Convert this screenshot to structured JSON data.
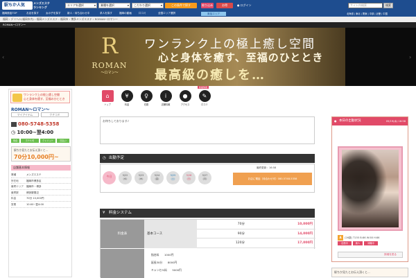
{
  "header": {
    "logo": "駅ちか人気",
    "logo_tag": "メンズエステ\nランキング",
    "select1": "エリアを選択",
    "select2": "業種を選択",
    "select3": "こだわり選択",
    "search_btn": "この条件で探す",
    "btn2": "絞り込み",
    "btn3": "お得",
    "login": "ログイン",
    "search_placeholder": "サイト内検索",
    "search_btn2": "検索"
  },
  "nav2": [
    "福岡風俗TOP",
    "お店を探す",
    "女の子を探す",
    "新人・待ち合わせ中",
    "求人を探す",
    "福岡の動画",
    "口コミ",
    "全国エリア選択",
    "風俗エリア"
  ],
  "nav3": "北海道 | 東北 | 関東 | 中部 | 近畿 | 中国",
  "breadcrumb": "福岡 › デリヘル(福岡市内) › 福岡メンズエステ › 福岡市 › 博多メンズエステ › ROMAN～ロマン～",
  "breadcrumb2": "ROMAN～ロマン～",
  "banner": {
    "t1": "ワンランク上の極上癒し空間",
    "t2": "心と身体を癒す、至福のひととき",
    "t3": "最高級の癒しを…",
    "logo_name": "ROMAN",
    "logo_sub": "～ロマン～",
    "logo_mark": "R"
  },
  "left": {
    "banner_text": "ワンランク上の極上癒し空間\n心と身体を癒す、至福のひととき",
    "shop_name": "ROMAN～ロマン～",
    "btn_a": "マイアイテム",
    "btn_b": "クチコミ",
    "tel": "080-5748-5358",
    "time": "10:00~翌4:00",
    "tags": [
      "待合",
      "ホテル可",
      "クレジット",
      "日払い"
    ],
    "price_sub": "駅ちか見たとお伝え頂くと...",
    "price_val": "70分10,000円~",
    "sec_title": "店舗基本情報",
    "info": [
      {
        "k": "業種",
        "v": "メンズエステ"
      },
      {
        "k": "所在地",
        "v": "福岡市博多区"
      },
      {
        "k": "最寄エリア",
        "v": "福岡市・博多"
      },
      {
        "k": "最寄駅",
        "v": "博多駅周辺"
      },
      {
        "k": "料金",
        "v": "70分 10,000円"
      },
      {
        "k": "営業",
        "v": "10:00~翌4:00"
      }
    ]
  },
  "icons": {
    "new_tag": "新着情報",
    "items": [
      "トップ",
      "料金",
      "在籍",
      "店舗情報",
      "アクセス",
      "口コミ"
    ]
  },
  "message": "お待ちしております♪",
  "schedule": {
    "title": "出勤予定",
    "updated": "最終更新：16:58",
    "dates": [
      {
        "d": "今日",
        "w": ""
      },
      {
        "d": "5/22",
        "w": "(水)"
      },
      {
        "d": "5/23",
        "w": "(木)"
      },
      {
        "d": "5/24",
        "w": "(金)"
      },
      {
        "d": "5/25",
        "w": "(土)"
      },
      {
        "d": "5/26",
        "w": "(日)"
      },
      {
        "d": "5/27",
        "w": "(月)"
      }
    ],
    "button": "お店に電話（待合わせ可）080-5748-5358"
  },
  "price": {
    "title": "料金システム",
    "label": "料金表",
    "course": "基本コース",
    "rows": [
      {
        "d": "70分",
        "p": "10,000円"
      },
      {
        "d": "90分",
        "p": "14,000円"
      },
      {
        "d": "120分",
        "p": "17,000円"
      }
    ],
    "options": [
      "指名料　　1000円",
      "延長30分　　8000円",
      "キャンセル料　　5000円"
    ]
  },
  "right": {
    "title": "本日の出勤状況",
    "date": "05/19(水) 16:58",
    "name": "A",
    "info": "(26歳) T155 B:86 W:58 H:86",
    "tags": [
      "出勤中",
      "新人",
      "待機中"
    ],
    "more": "詳細を見る",
    "bottom": "駅ちか見たとお伝え頂くと..."
  }
}
